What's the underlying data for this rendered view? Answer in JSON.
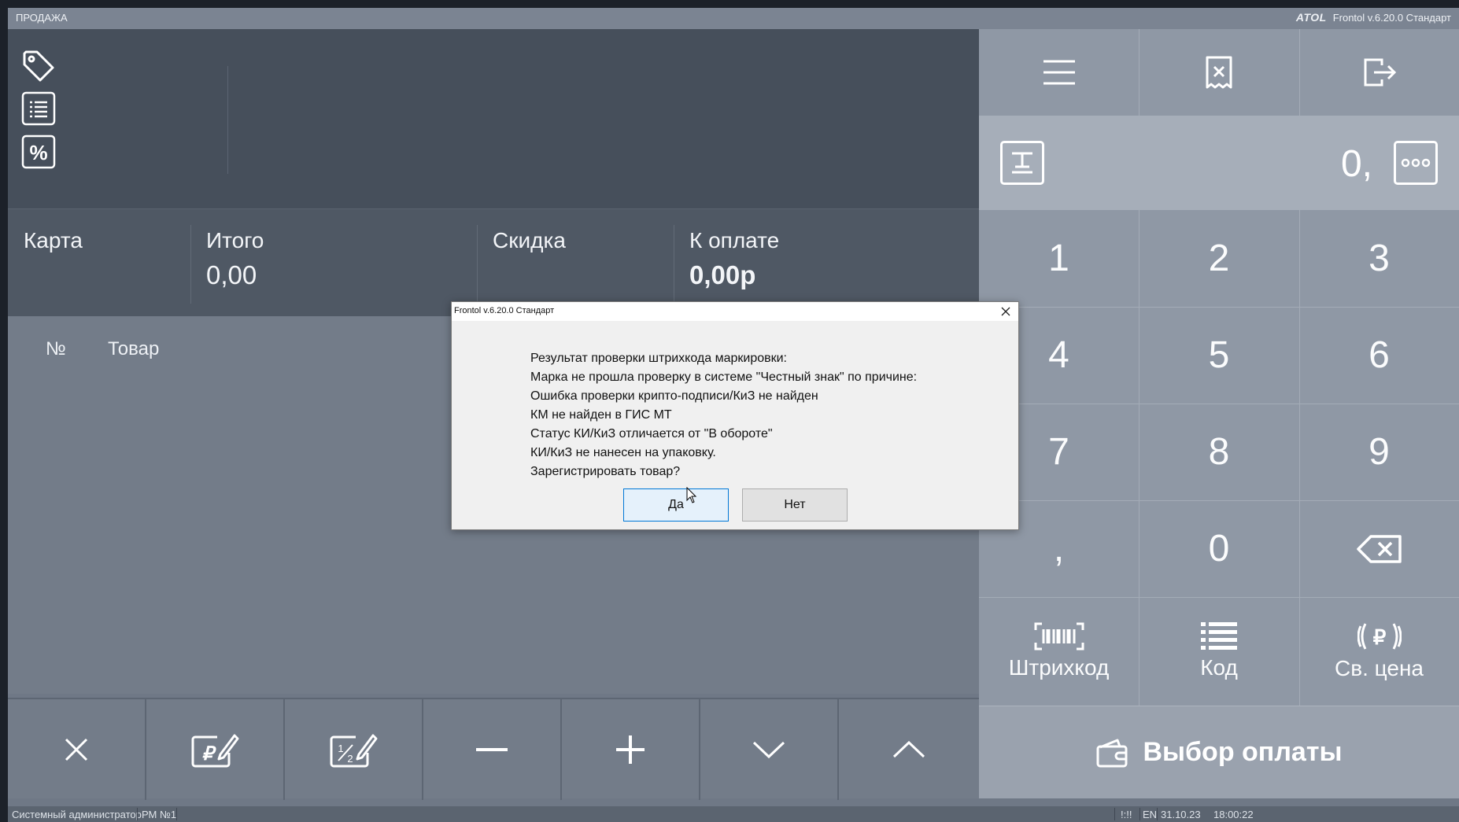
{
  "titlebar": {
    "mode": "ПРОДАЖА",
    "logo": "ATOL",
    "version": "Frontol v.6.20.0 Стандарт"
  },
  "totals": {
    "card_label": "Карта",
    "total_label": "Итого",
    "total_value": "0,00",
    "discount_label": "Скидка",
    "to_pay_label": "К оплате",
    "to_pay_value": "0,00р"
  },
  "receipt": {
    "col_no": "№",
    "col_item": "Товар"
  },
  "keypad": {
    "quantity": "0,",
    "keys": [
      "1",
      "2",
      "3",
      "4",
      "5",
      "6",
      "7",
      "8",
      "9",
      ",",
      "0"
    ],
    "barcode_label": "Штрихкод",
    "code_label": "Код",
    "free_price_label": "Св. цена",
    "payment_label": "Выбор оплаты"
  },
  "statusbar": {
    "user": "Системный администратор",
    "workstation": "РМ №1",
    "indicator": "!:!!",
    "lang": "EN",
    "date": "31.10.23",
    "time": "18:00:22"
  },
  "dialog": {
    "title": "Frontol v.6.20.0 Стандарт",
    "lines": [
      "Результат проверки штрихкода маркировки:",
      "Марка не прошла проверку в системе \"Честный знак\" по причине:",
      "Ошибка проверки крипто-подписи/КиЗ не найден",
      "КМ не найден в ГИС МТ",
      "Статус КИ/КиЗ отличается от \"В обороте\"",
      "КИ/КиЗ не нанесен на упаковку.",
      "Зарегистрировать товар?"
    ],
    "yes_label": "Да",
    "no_label": "Нет"
  }
}
